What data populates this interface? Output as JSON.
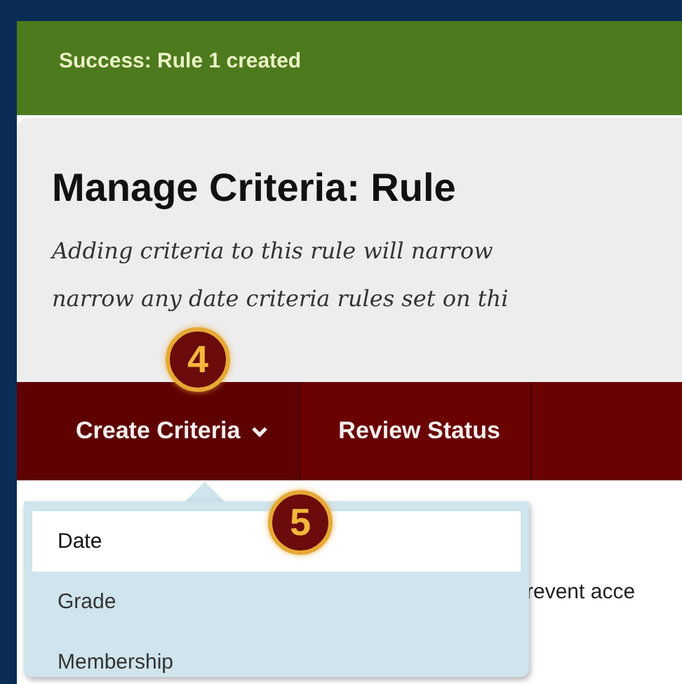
{
  "banner": {
    "message": "Success: Rule 1 created"
  },
  "header": {
    "title": "Manage Criteria: Rule",
    "description": [
      "Adding criteria to this rule will narrow",
      "narrow any date criteria rules set on thi"
    ]
  },
  "nav": {
    "tabs": [
      {
        "label": "Create Criteria",
        "has_menu": true
      },
      {
        "label": "Review Status",
        "has_menu": false
      }
    ]
  },
  "menu": {
    "items": [
      {
        "label": "Date",
        "selected": true
      },
      {
        "label": "Grade",
        "selected": false
      },
      {
        "label": "Membership",
        "selected": false
      }
    ]
  },
  "body_text": "revent acce",
  "callouts": [
    {
      "number": "4"
    },
    {
      "number": "5"
    }
  ]
}
